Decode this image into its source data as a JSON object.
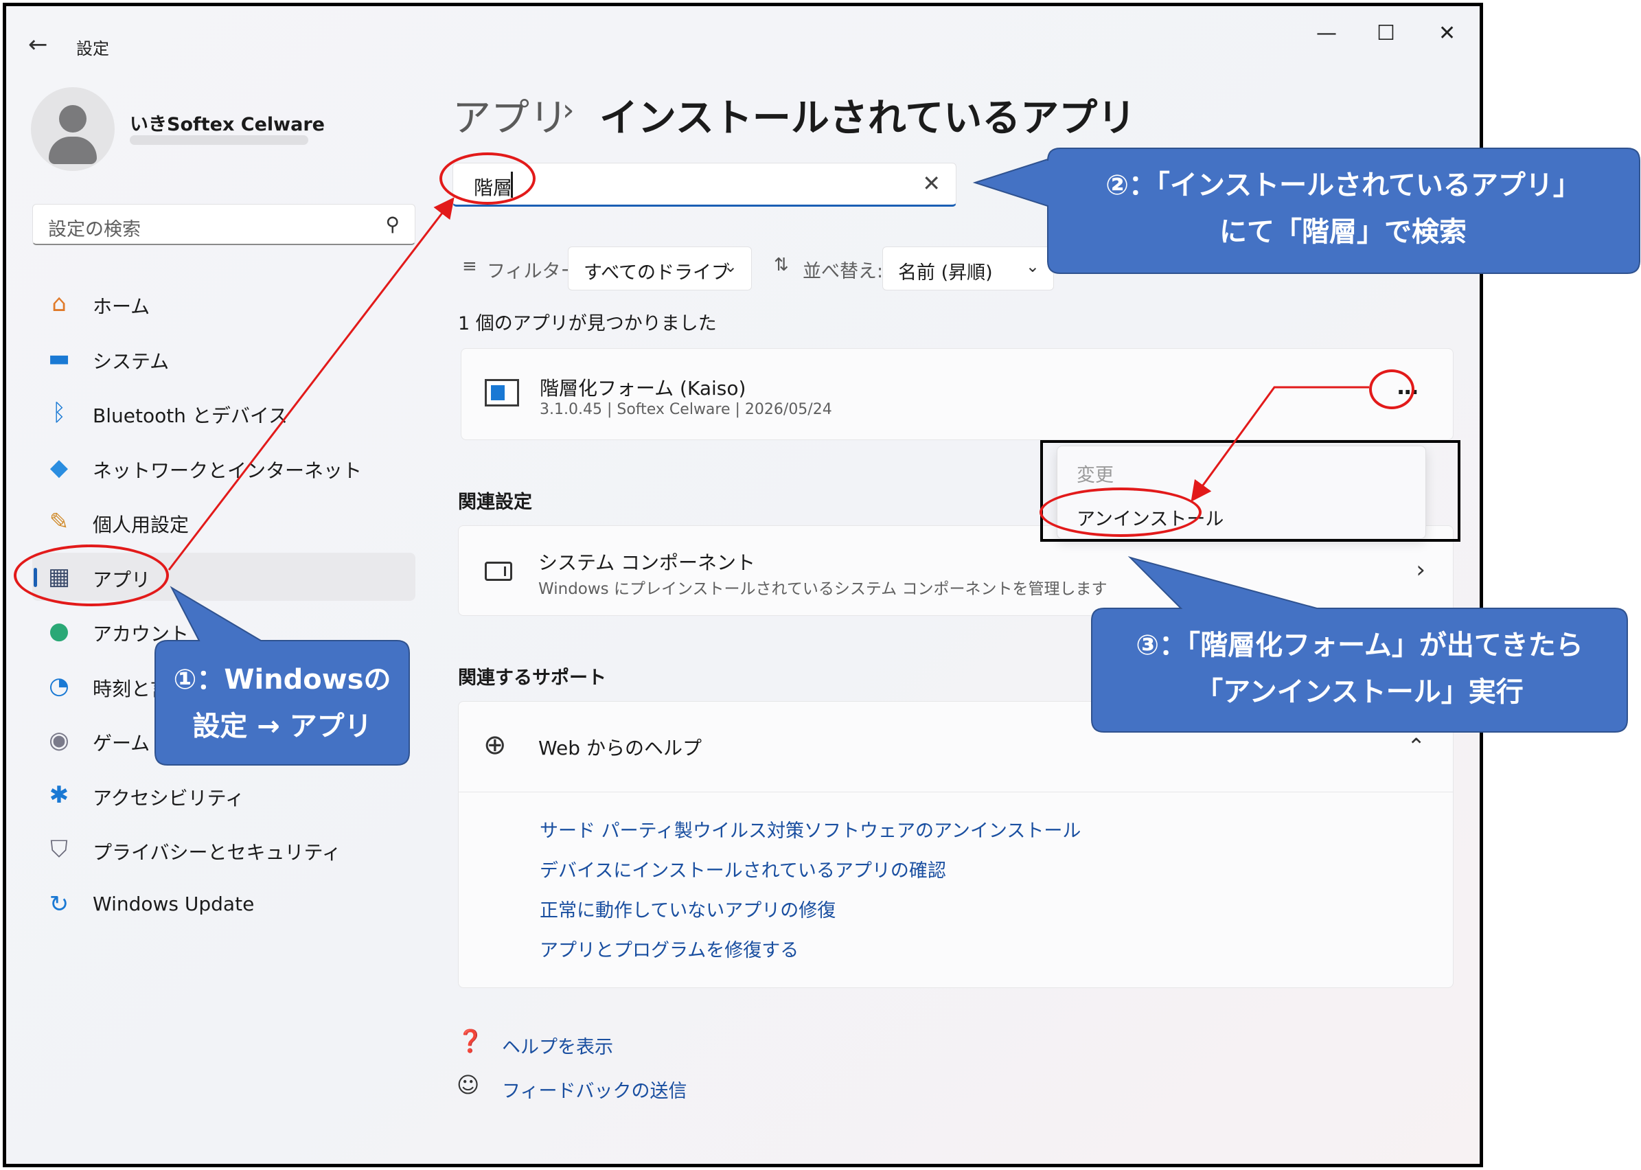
{
  "window": {
    "title": "設定",
    "back_glyph": "←",
    "controls": {
      "minimize": "—",
      "maximize": "☐",
      "close": "✕"
    }
  },
  "profile": {
    "name": "いきSoftex Celware"
  },
  "sidebar": {
    "search_placeholder": "設定の検索",
    "search_icon": "⚲",
    "items": [
      {
        "label": "ホーム",
        "icon": "home-icon",
        "glyph": "⌂",
        "color": "#e07a2a"
      },
      {
        "label": "システム",
        "icon": "system-icon",
        "glyph": "▬",
        "color": "#1a79d4"
      },
      {
        "label": "Bluetooth とデバイス",
        "icon": "bluetooth-icon",
        "glyph": "ᛒ",
        "color": "#1a79d4"
      },
      {
        "label": "ネットワークとインターネット",
        "icon": "wifi-icon",
        "glyph": "◆",
        "color": "#2a8de0"
      },
      {
        "label": "個人用設定",
        "icon": "brush-icon",
        "glyph": "✎",
        "color": "#d08a2a"
      },
      {
        "label": "アプリ",
        "icon": "apps-icon",
        "glyph": "▦",
        "color": "#3a4a6a",
        "selected": true
      },
      {
        "label": "アカウント",
        "icon": "account-icon",
        "glyph": "●",
        "color": "#2aa876"
      },
      {
        "label": "時刻と言",
        "icon": "clock-icon",
        "glyph": "◔",
        "color": "#1a79d4"
      },
      {
        "label": "ゲーム",
        "icon": "game-icon",
        "glyph": "◉",
        "color": "#7a7a8a"
      },
      {
        "label": "アクセシビリティ",
        "icon": "accessibility-icon",
        "glyph": "✱",
        "color": "#1a79d4"
      },
      {
        "label": "プライバシーとセキュリティ",
        "icon": "shield-icon",
        "glyph": "⛉",
        "color": "#6a6a7a"
      },
      {
        "label": "Windows Update",
        "icon": "update-icon",
        "glyph": "↻",
        "color": "#1a79d4"
      }
    ]
  },
  "header": {
    "parent": "アプリ",
    "separator": "›",
    "current": "インストールされているアプリ"
  },
  "search": {
    "value": "階層",
    "clear_glyph": "✕"
  },
  "filter": {
    "label": "フィルター:",
    "value": "すべてのドライブ",
    "sort_label": "並べ替え:",
    "sort_value": "名前 (昇順)",
    "chevron": "⌄"
  },
  "results_count": "1 個のアプリが見つかりました",
  "app": {
    "name": "階層化フォーム (Kaiso)",
    "meta": "3.1.0.45   |   Softex Celware   |   2026/05/24",
    "more_glyph": "···"
  },
  "context_menu": {
    "modify": "変更",
    "uninstall": "アンインストール"
  },
  "related_settings": {
    "heading": "関連設定",
    "title": "システム コンポーネント",
    "description": "Windows にプレインストールされているシステム コンポーネントを管理します",
    "chevron": "›"
  },
  "related_support": {
    "heading": "関連するサポート",
    "title": "Web からのヘルプ",
    "chevron": "⌃",
    "links": [
      "サード パーティ製ウイルス対策ソフトウェアのアンインストール",
      "デバイスにインストールされているアプリの確認",
      "正常に動作していないアプリの修復",
      "アプリとプログラムを修復する"
    ]
  },
  "footer": {
    "help": "ヘルプを表示",
    "feedback": "フィードバックの送信"
  },
  "annotations": {
    "step1": [
      "①：Windowsの",
      "設定 → アプリ"
    ],
    "step2": [
      "②：「インストールされているアプリ」",
      "にて「階層」で検索"
    ],
    "step3": [
      "③：「階層化フォーム」が出てきたら",
      "「アンインストール」実行"
    ],
    "callout_color": "#4472c4",
    "highlight_color": "#e21a1a"
  }
}
